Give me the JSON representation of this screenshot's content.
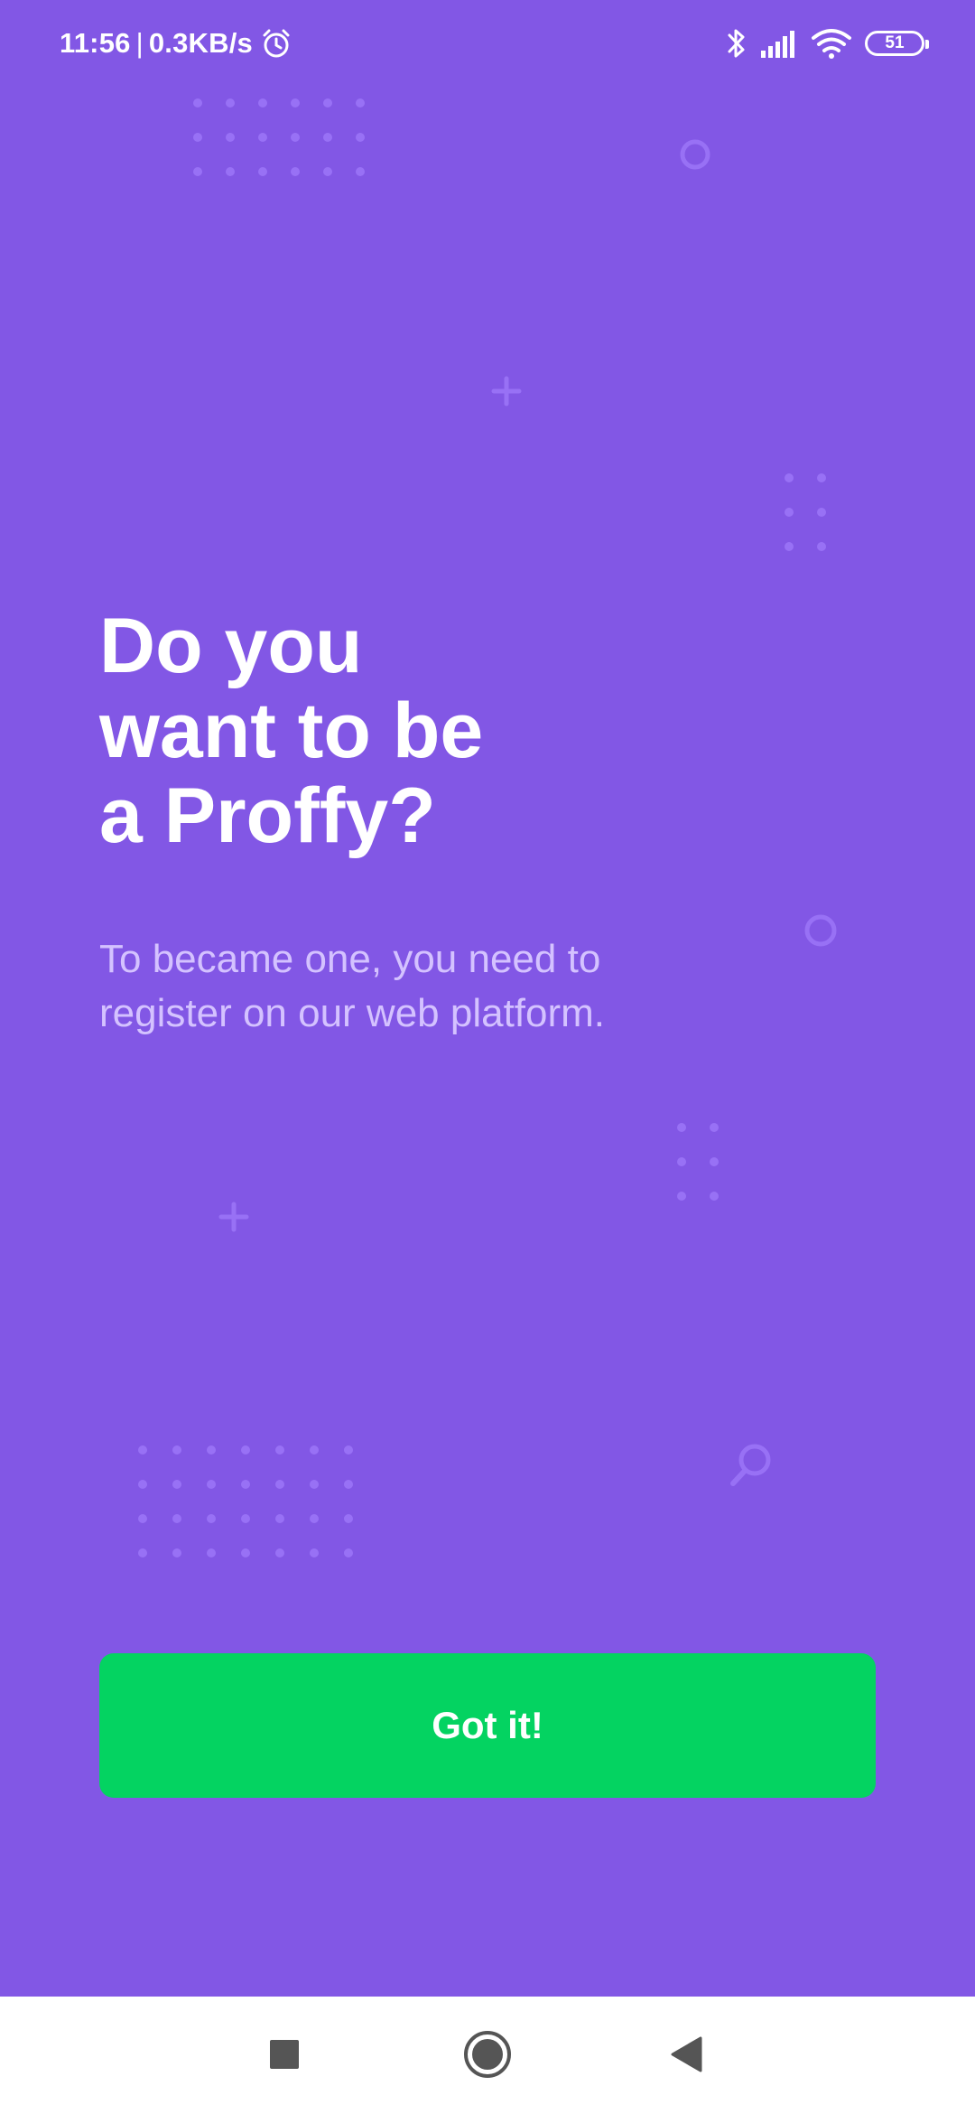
{
  "status_bar": {
    "time": "11:56",
    "separator": "|",
    "network_speed": "0.3KB/s",
    "battery_level": "51",
    "icons": [
      "alarm-icon",
      "bluetooth-icon",
      "signal-icon",
      "wifi-icon",
      "battery-icon"
    ]
  },
  "onboarding": {
    "title": "Do you\nwant to be\na Proffy?",
    "description": "To became one, you need to\nregister on our web platform.",
    "button_label": "Got it!"
  },
  "nav_bar": {
    "icons": [
      "recent-apps-icon",
      "home-icon",
      "back-icon"
    ]
  },
  "colors": {
    "background": "#8257E5",
    "decoration": "#9871F5",
    "description_text": "#D4C2FF",
    "button": "#04D361",
    "button_text": "#FFFFFF",
    "nav_bar": "#FFFFFF",
    "nav_icons": "#555555"
  }
}
